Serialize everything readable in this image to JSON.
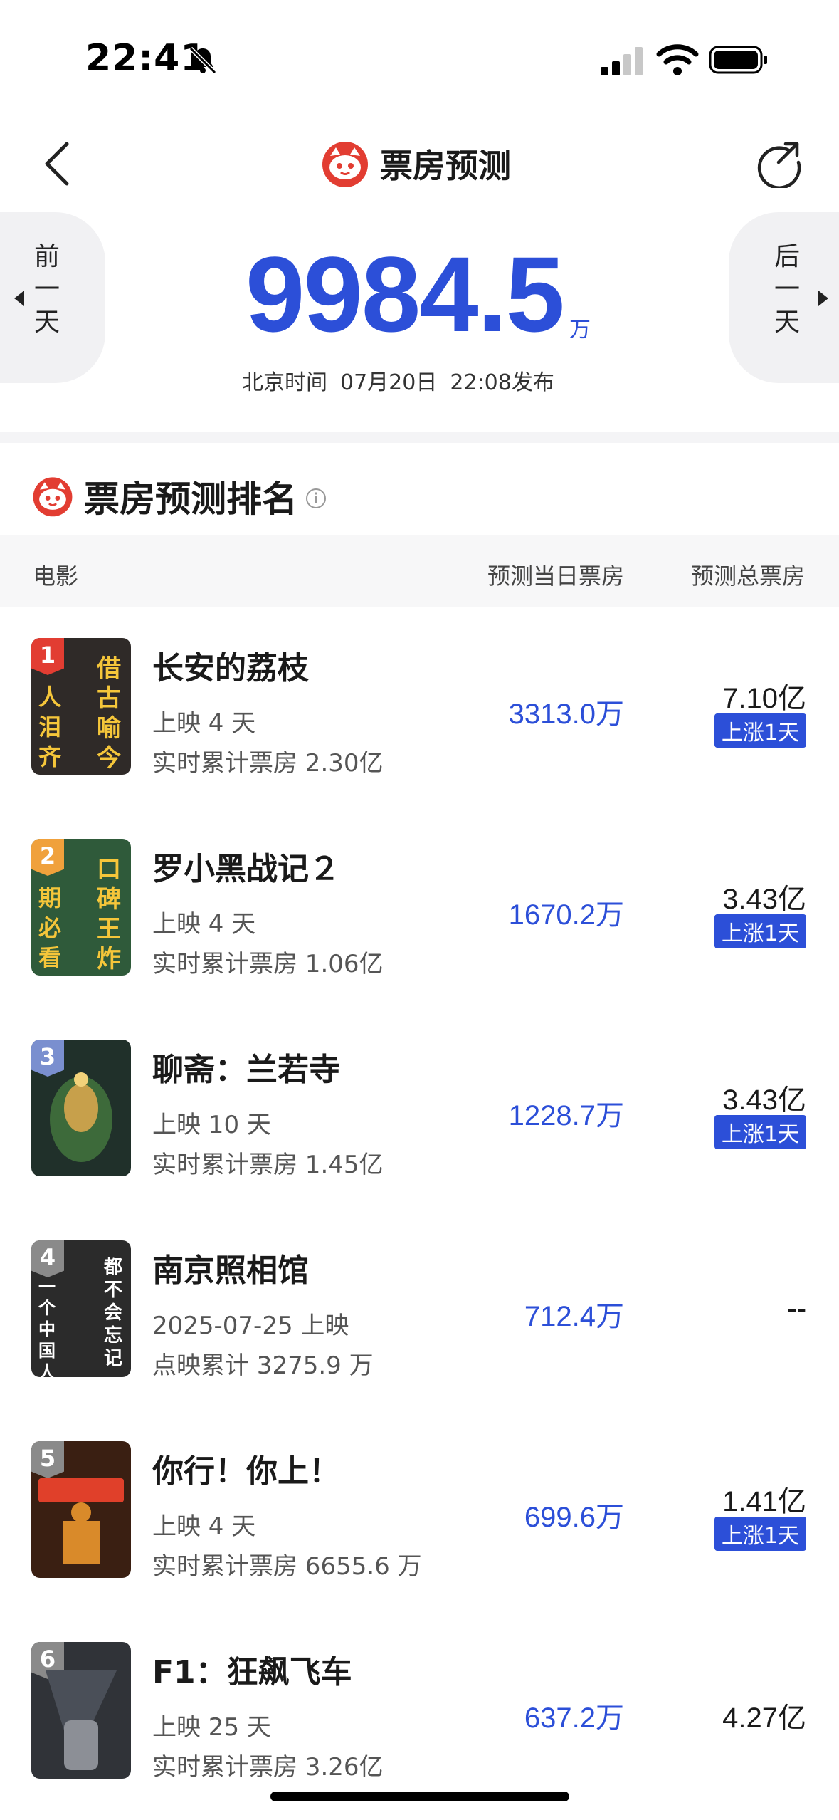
{
  "status_bar": {
    "time": "22:41"
  },
  "header": {
    "title": "票房预测"
  },
  "summary": {
    "prev_day": [
      "前",
      "一",
      "天"
    ],
    "next_day": [
      "后",
      "一",
      "天"
    ],
    "amount": "9984.5",
    "unit": "万",
    "timezone_label": "北京时间",
    "date": "07月20日",
    "time": "22:08发布"
  },
  "ranking": {
    "title": "票房预测排名",
    "columns": {
      "movie": "电影",
      "daily": "预测当日票房",
      "total": "预测总票房"
    },
    "movies": [
      {
        "rank": "1",
        "title": "长安的荔枝",
        "sub1": "上映 4 天",
        "sub2": "实时累计票房 2.30亿",
        "daily": "3313.0万",
        "total": "7.10亿",
        "badge": "上涨1天",
        "poster_a": "借古喻今",
        "poster_b": "人泪齐飞"
      },
      {
        "rank": "2",
        "title": "罗小黑战记２",
        "sub1": "上映 4 天",
        "sub2": "实时累计票房 1.06亿",
        "daily": "1670.2万",
        "total": "3.43亿",
        "badge": "上涨1天",
        "poster_a": "口碑王炸",
        "poster_b": "期必看"
      },
      {
        "rank": "3",
        "title": "聊斋：兰若寺",
        "sub1": "上映 10 天",
        "sub2": "实时累计票房 1.45亿",
        "daily": "1228.7万",
        "total": "3.43亿",
        "badge": "上涨1天",
        "poster_a": "",
        "poster_b": ""
      },
      {
        "rank": "4",
        "title": "南京照相馆",
        "sub1": "2025-07-25 上映",
        "sub2": "点映累计 3275.9 万",
        "daily": "712.4万",
        "total": "--",
        "badge": "",
        "poster_a": "都不会忘记",
        "poster_b": "一个中国人"
      },
      {
        "rank": "5",
        "title": "你行！你上！",
        "sub1": "上映 4 天",
        "sub2": "实时累计票房 6655.6 万",
        "daily": "699.6万",
        "total": "1.41亿",
        "badge": "上涨1天",
        "poster_a": "",
        "poster_b": ""
      },
      {
        "rank": "6",
        "title": "F1：狂飙飞车",
        "sub1": "上映 25 天",
        "sub2": "实时累计票房 3.26亿",
        "daily": "637.2万",
        "total": "4.27亿",
        "badge": "",
        "poster_a": "",
        "poster_b": ""
      }
    ]
  },
  "colors": {
    "accent": "#2c4fd8",
    "rank_badges": [
      "#e23d32",
      "#f0a13c",
      "#7a8fcf",
      "#8a8a8a",
      "#8a8a8a",
      "#8a8a8a"
    ],
    "posters": [
      "#2f2a28",
      "#2f5a3a",
      "#20302a",
      "#2b2b2b",
      "#3a1f12",
      "#303338"
    ]
  }
}
